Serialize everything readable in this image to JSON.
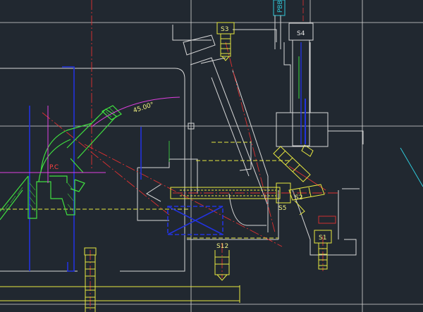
{
  "drawing": {
    "labels": {
      "s1": "S1",
      "s2": "S2",
      "s3": "S3",
      "s4": "S4",
      "s5": "S5",
      "s12": "S12",
      "pc": "P.C",
      "angle": "45.00°",
      "side_tag": "PBB"
    }
  },
  "colors": {
    "background": "#212830",
    "white_line": "#e6e6e6",
    "red_center": "#e03030",
    "yellow": "#e8e840",
    "green": "#40e040",
    "blue": "#2233dd",
    "magenta": "#e040e0",
    "cyan": "#30c8d8",
    "label_yellow": "#f0f080",
    "label_red": "#ff4040"
  }
}
